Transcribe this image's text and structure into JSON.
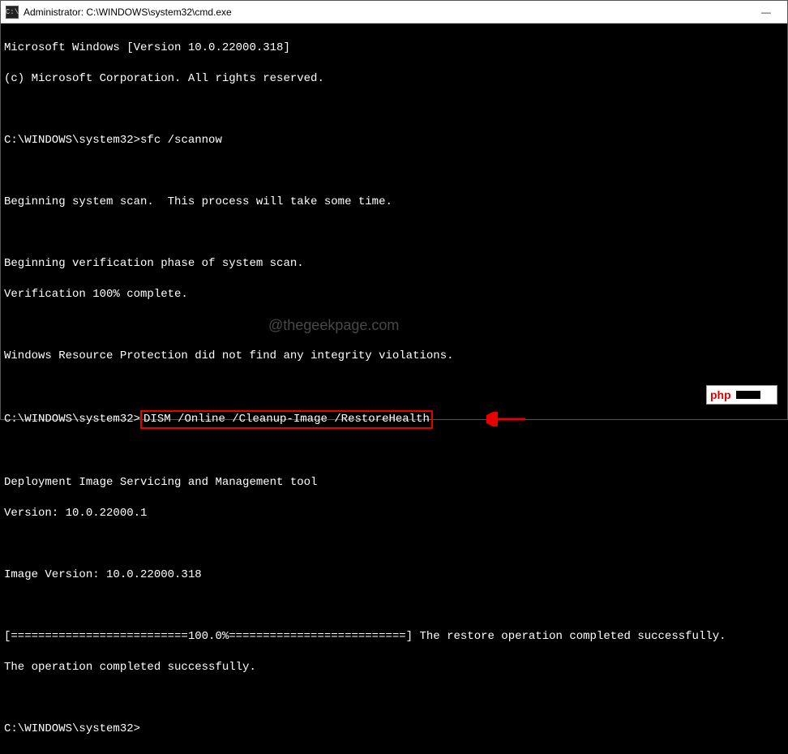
{
  "titlebar": {
    "icon_label": "C:\\",
    "title": "Administrator: C:\\WINDOWS\\system32\\cmd.exe"
  },
  "terminal": {
    "header1": "Microsoft Windows [Version 10.0.22000.318]",
    "header2": "(c) Microsoft Corporation. All rights reserved.",
    "prompt1_path": "C:\\WINDOWS\\system32>",
    "prompt1_cmd": "sfc /scannow",
    "scan1": "Beginning system scan.  This process will take some time.",
    "scan2": "Beginning verification phase of system scan.",
    "scan3": "Verification 100% complete.",
    "scan4": "Windows Resource Protection did not find any integrity violations.",
    "prompt2_path": "C:\\WINDOWS\\system32>",
    "prompt2_cmd": "DISM /Online /Cleanup-Image /RestoreHealth",
    "dism1": "Deployment Image Servicing and Management tool",
    "dism2": "Version: 10.0.22000.1",
    "dism3": "Image Version: 10.0.22000.318",
    "progress": "[==========================100.0%==========================] The restore operation completed successfully.",
    "done": "The operation completed successfully.",
    "prompt3_path": "C:\\WINDOWS\\system32>"
  },
  "watermark": "@thegeekpage.com",
  "badge": {
    "text": "php"
  }
}
